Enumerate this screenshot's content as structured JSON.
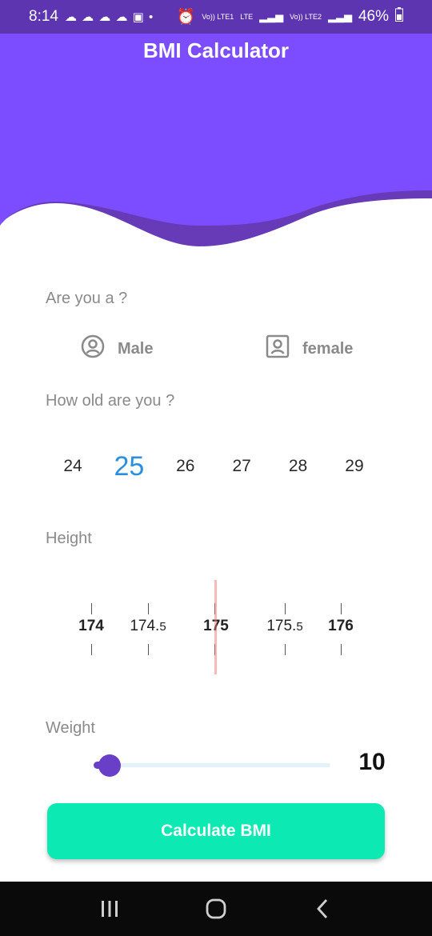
{
  "status_bar": {
    "time": "8:14",
    "notification_icons": "☁ ☁ ☁ ☁ ▣ •",
    "network_1": "Vo)) LTE1",
    "network_lte": "LTE",
    "network_2": "Vo)) LTE2",
    "battery": "46%"
  },
  "header": {
    "title": "BMI Calculator",
    "colors": {
      "primary": "#7c4dff",
      "wave": "#673ab7"
    }
  },
  "gender": {
    "label": "Are you a ?",
    "options": [
      "Male",
      "female"
    ]
  },
  "age": {
    "label": "How old are you ?",
    "values": [
      "24",
      "25",
      "26",
      "27",
      "28",
      "29"
    ],
    "selected": "25"
  },
  "height": {
    "label": "Height",
    "ticks": [
      {
        "main": "174",
        "sub": ""
      },
      {
        "main": "174.",
        "sub": "5"
      },
      {
        "main": "175",
        "sub": ""
      },
      {
        "main": "175.",
        "sub": "5"
      },
      {
        "main": "176",
        "sub": ""
      }
    ],
    "selected": "175"
  },
  "weight": {
    "label": "Weight",
    "value": "10",
    "slider_fraction": 0.06
  },
  "actions": {
    "calculate_label": "Calculate BMI"
  }
}
